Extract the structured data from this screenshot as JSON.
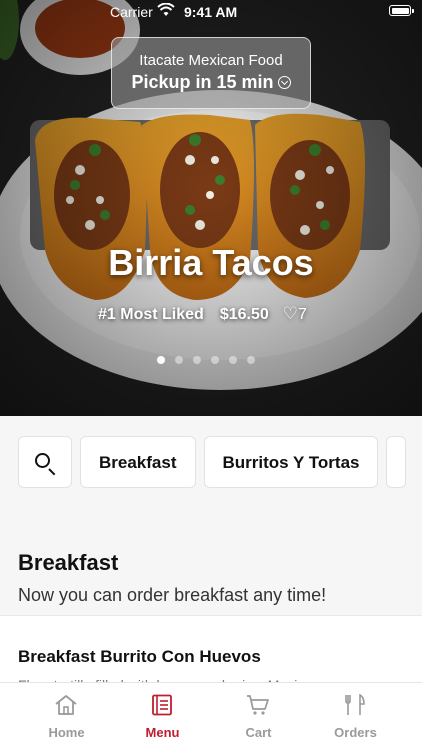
{
  "status_bar": {
    "carrier": "Carrier",
    "time": "9:41 AM"
  },
  "header": {
    "restaurant": "Itacate Mexican Food",
    "pickup": "Pickup in 15 min"
  },
  "hero": {
    "title": "Birria Tacos",
    "badge": "#1 Most Liked",
    "price": "$16.50",
    "likes": "7",
    "carousel_pages": 6,
    "carousel_active": 1
  },
  "categories": [
    "Breakfast",
    "Burritos Y Tortas"
  ],
  "section": {
    "title": "Breakfast",
    "subtitle": "Now you can order breakfast any time!"
  },
  "menu_items": [
    {
      "name": "Breakfast Burrito Con Huevos",
      "description": "Flour tortilla filled with bacon or chorizo, Mexican"
    }
  ],
  "tabs": [
    {
      "label": "Home",
      "icon": "home-icon",
      "active": false
    },
    {
      "label": "Menu",
      "icon": "menu-icon",
      "active": true
    },
    {
      "label": "Cart",
      "icon": "cart-icon",
      "active": false
    },
    {
      "label": "Orders",
      "icon": "orders-icon",
      "active": false
    }
  ],
  "colors": {
    "accent": "#c21d2f",
    "tab_inactive": "#9a9a9a"
  }
}
